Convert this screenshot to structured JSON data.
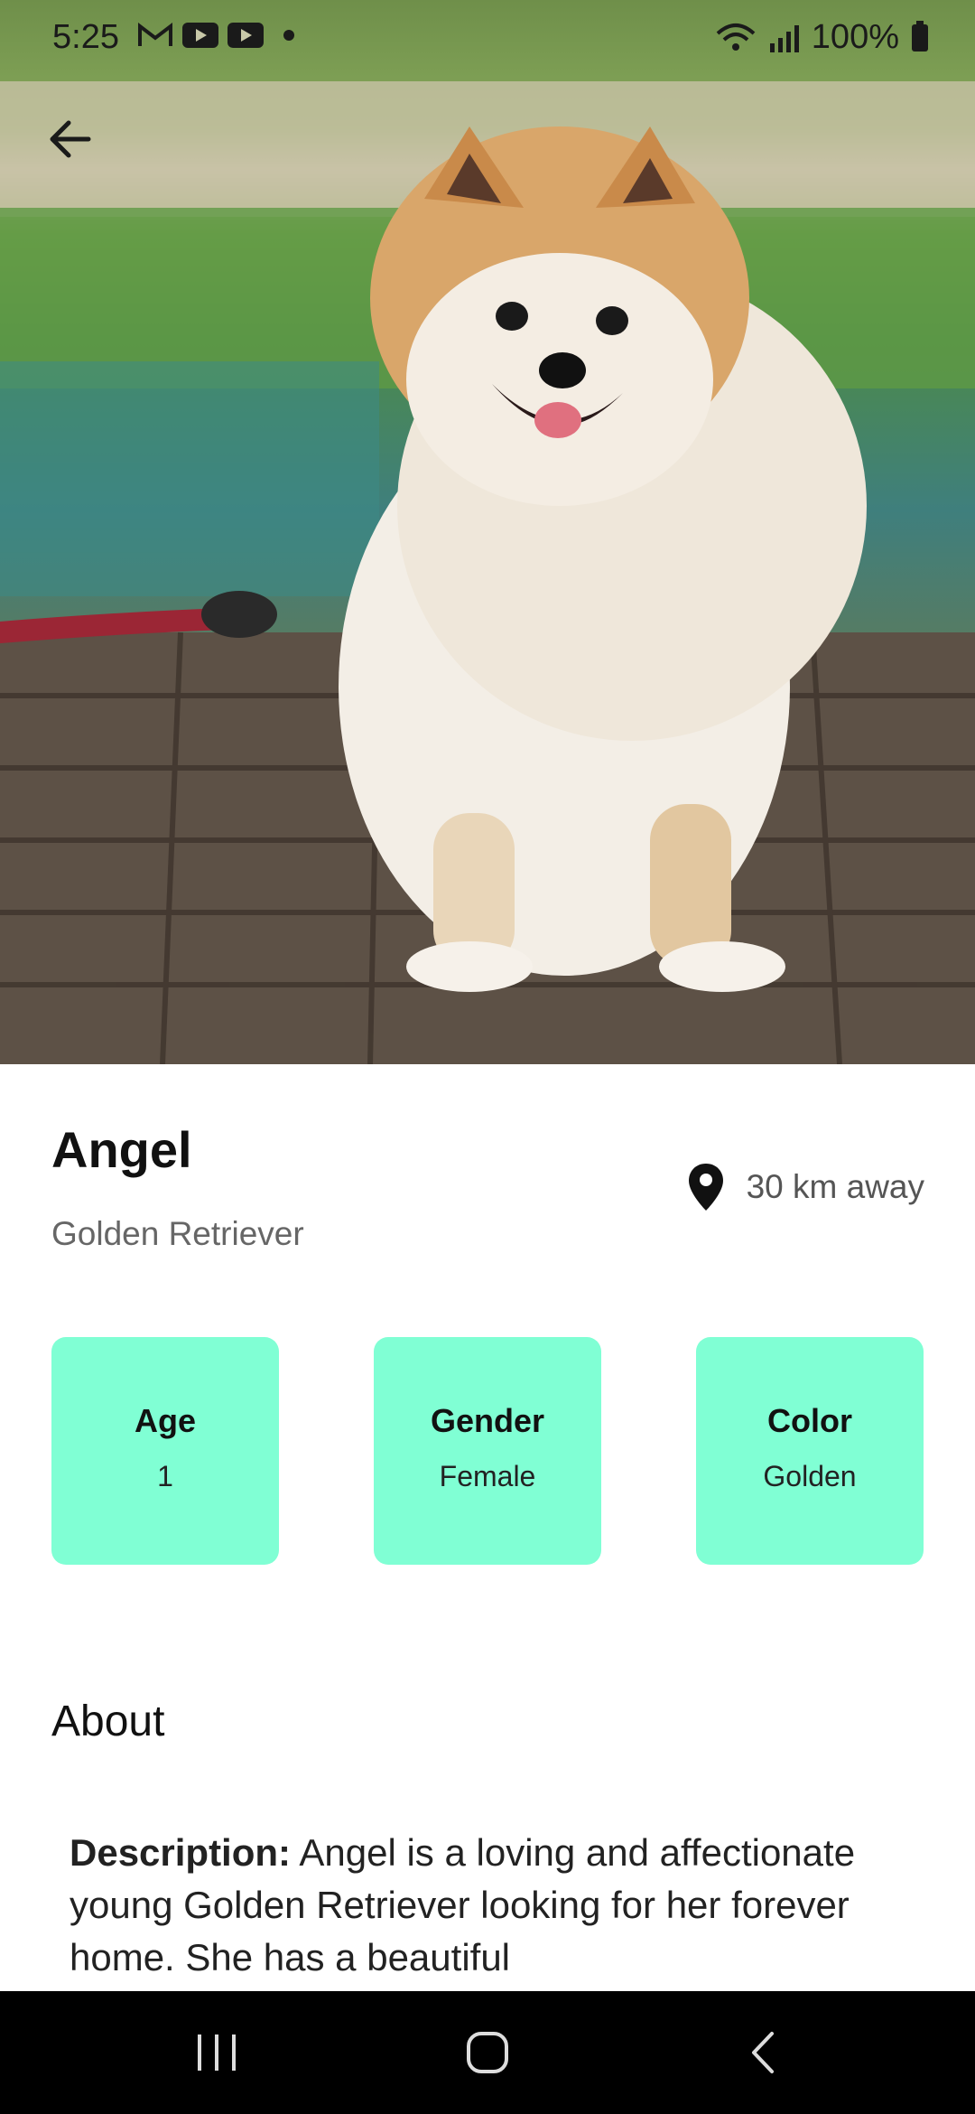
{
  "status_bar": {
    "time": "5:25",
    "battery": "100%",
    "icons": [
      "gmail-icon",
      "youtube-icon",
      "youtube-icon",
      "notification-dot",
      "wifi-icon",
      "signal-icon",
      "battery-icon"
    ]
  },
  "header": {
    "back_icon": "arrow-left-icon"
  },
  "pet": {
    "name": "Angel",
    "breed": "Golden Retriever",
    "distance": "30 km away",
    "location_icon": "map-pin-icon"
  },
  "attributes": [
    {
      "title": "Age",
      "value": "1"
    },
    {
      "title": "Gender",
      "value": "Female"
    },
    {
      "title": "Color",
      "value": "Golden"
    }
  ],
  "about": {
    "title": "About",
    "description_label": "Description:",
    "description": "Angel is a loving and affectionate young Golden Retriever looking for her forever home. She has a beautiful"
  },
  "colors": {
    "card_bg": "#80ffd4",
    "nav_bg": "#000000"
  },
  "nav_bar": {
    "items": [
      "recent-apps-icon",
      "home-icon",
      "back-icon"
    ]
  }
}
